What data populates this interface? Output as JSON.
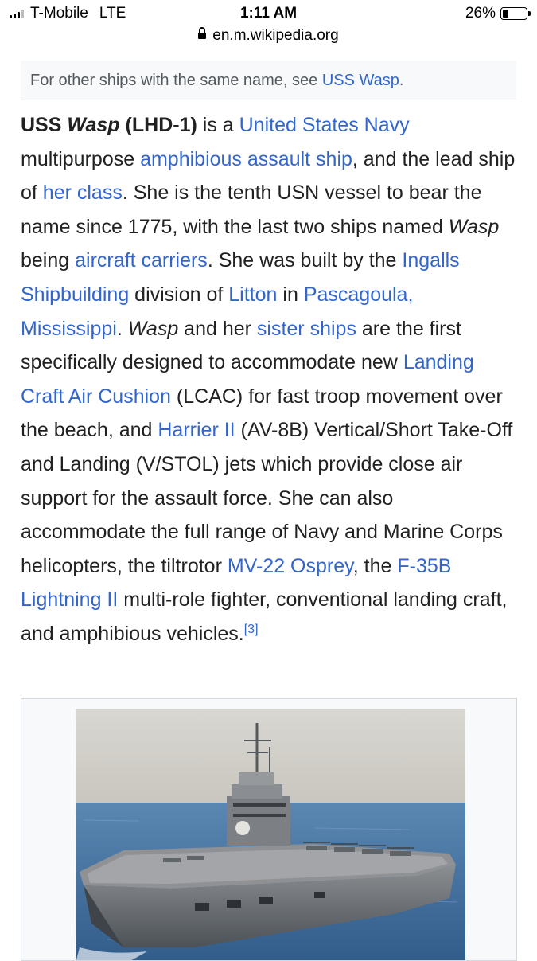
{
  "status": {
    "carrier": "T-Mobile",
    "network": "LTE",
    "time": "1:11 AM",
    "battery_percent": "26%",
    "battery_level": 0.26
  },
  "urlbar": {
    "url": "en.m.wikipedia.org"
  },
  "hatnote": {
    "prefix": "For other ships with the same name, see ",
    "link": "USS Wasp",
    "suffix": "."
  },
  "article": {
    "t01": "USS ",
    "t02": "Wasp",
    "t03": " (LHD-1)",
    "t04": " is a ",
    "l01": "United States Navy",
    "t05": " multipurpose ",
    "l02": "amphibious assault ship",
    "t06": ", and the lead ship of ",
    "l03": "her class",
    "t07": ". She is the tenth USN vessel to bear the name since 1775, with the last two ships named ",
    "t08": "Wasp",
    "t09": " being ",
    "l04": "aircraft carriers",
    "t10": ". She was built by the ",
    "l05": "Ingalls Shipbuilding",
    "t11": " division of ",
    "l06": "Litton",
    "t12": " in ",
    "l07": "Pascagoula, Mississippi",
    "t13": ". ",
    "t14": "Wasp",
    "t15": " and her ",
    "l08": "sister ships",
    "t16": " are the first specifically designed to accommodate new ",
    "l09": "Landing Craft Air Cushion",
    "t17": " (LCAC) for fast troop movement over the beach, and ",
    "l10": "Harrier II",
    "t18": " (AV-8B) Vertical/Short Take-Off and Landing (V/STOL) jets which provide close air support for the assault force. She can also accommodate the full range of Navy and Marine Corps helicopters, the tiltrotor ",
    "l11": "MV-22 Osprey",
    "t19": ", the ",
    "l12": "F-35B Lightning II",
    "t20": " multi-role fighter, conventional landing craft, and amphibious vehicles.",
    "ref": "[3]"
  },
  "colors": {
    "link": "#3366cc",
    "text": "#202122",
    "hatnote_bg": "#f8f9fa"
  }
}
